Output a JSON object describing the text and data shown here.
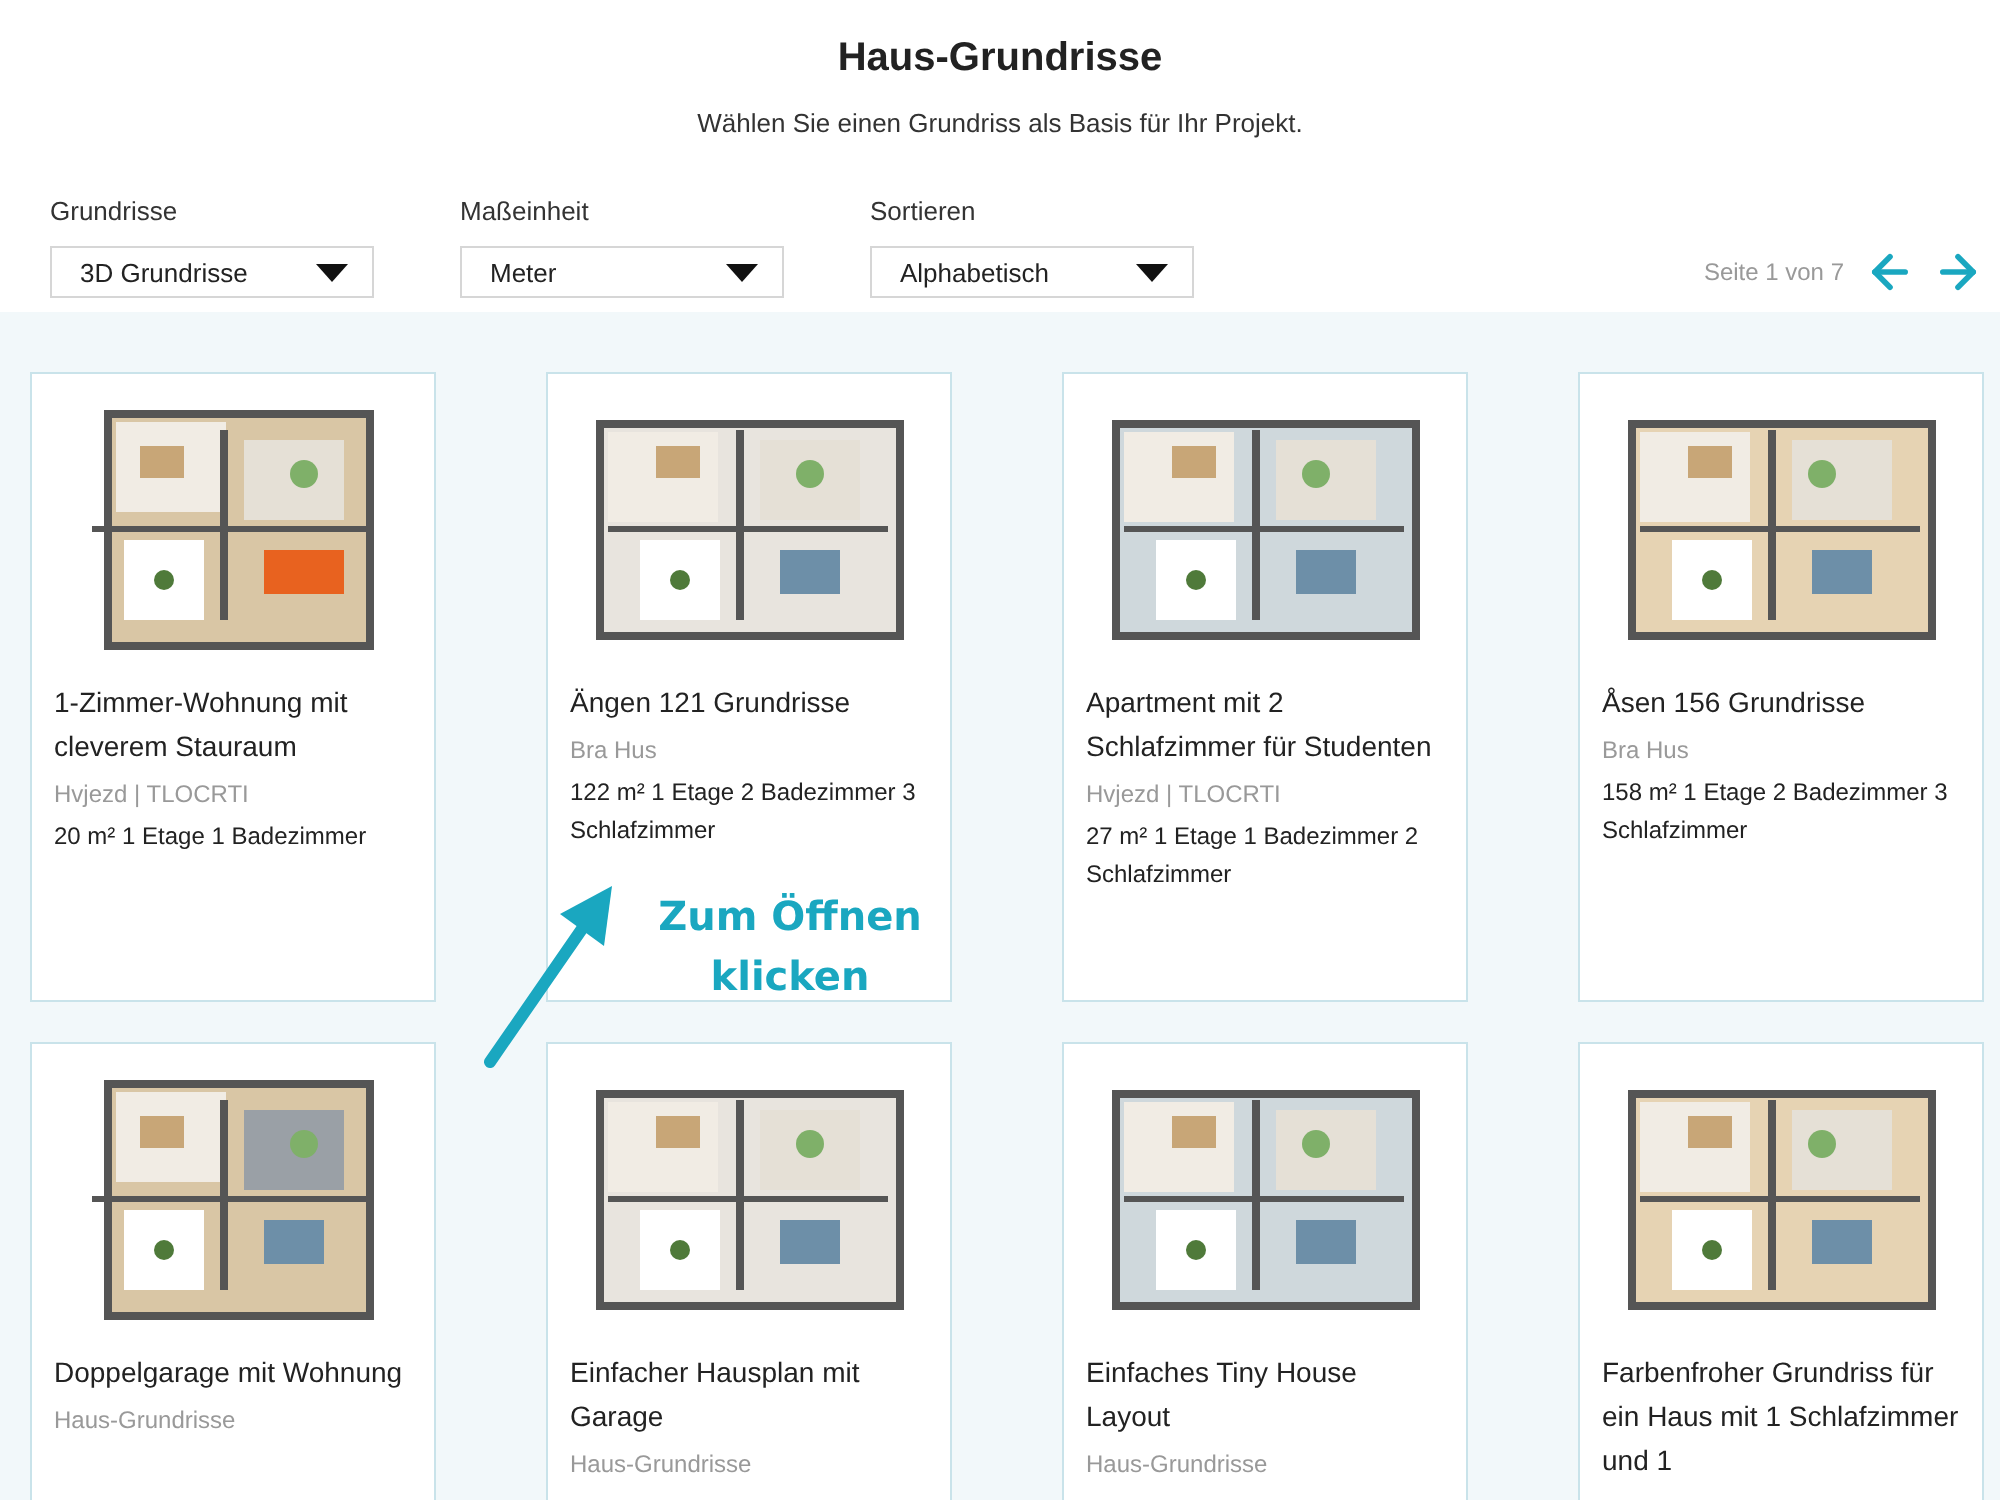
{
  "page": {
    "title": "Haus-Grundrisse",
    "subtitle": "Wählen Sie einen Grundriss als Basis für Ihr Projekt."
  },
  "filters": [
    {
      "label": "Grundrisse",
      "value": "3D Grundrisse"
    },
    {
      "label": "Maßeinheit",
      "value": "Meter"
    },
    {
      "label": "Sortieren",
      "value": "Alphabetisch"
    }
  ],
  "pagination": {
    "text": "Seite 1 von 7"
  },
  "plans": [
    {
      "title": "1-Zimmer-Wohnung mit cleverem Stauraum",
      "source": "Hvjezd | TLOCRTI",
      "details": "20 m² 1 Etage 1 Badezimmer"
    },
    {
      "title": "Ängen 121 Grundrisse",
      "source": "Bra Hus",
      "details": "122 m² 1 Etage 2 Badezimmer 3 Schlafzimmer"
    },
    {
      "title": "Apartment mit 2 Schlafzimmer für Studenten",
      "source": "Hvjezd | TLOCRTI",
      "details": "27 m² 1 Etage 1 Badezimmer 2 Schlafzimmer"
    },
    {
      "title": "Åsen 156 Grundrisse",
      "source": "Bra Hus",
      "details": "158 m² 1 Etage 2 Badezimmer 3 Schlafzimmer"
    },
    {
      "title": "Doppelgarage mit Wohnung",
      "source": "Haus-Grundrisse"
    },
    {
      "title": "Einfacher Hausplan mit Garage",
      "source": "Haus-Grundrisse"
    },
    {
      "title": "Einfaches Tiny House Layout",
      "source": "Haus-Grundrisse"
    },
    {
      "title": "Farbenfroher Grundriss für ein Haus mit 1 Schlafzimmer und 1"
    }
  ],
  "callout": {
    "text": "Zum Öffnen klicken"
  }
}
